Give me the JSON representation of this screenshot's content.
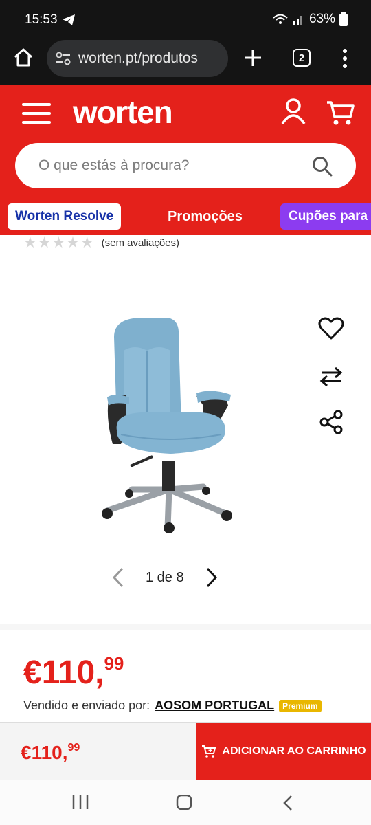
{
  "status_bar": {
    "time": "15:53",
    "battery": "63%"
  },
  "browser": {
    "url": "worten.pt/produtos",
    "tab_count": "2"
  },
  "header": {
    "logo": "worten",
    "search_placeholder": "O que estás à procura?",
    "nav": [
      "Worten Resolve",
      "Promoções",
      "Cupões para"
    ]
  },
  "product": {
    "rating_text": "(sem avaliações)",
    "gallery": "1 de 8",
    "price_int": "€110,",
    "price_dec": "99",
    "seller_label": "Vendido e enviado por:",
    "seller_name": "AOSOM PORTUGAL",
    "seller_badge": "Premium"
  },
  "buy_bar": {
    "price_int": "€110,",
    "price_dec": "99",
    "add_to_cart": "ADICIONAR AO CARRINHO"
  },
  "colors": {
    "brand_red": "#e4211b",
    "resolve_blue": "#1833a8",
    "coupon_purple": "#8c3cf0",
    "premium_gold": "#e9b700"
  }
}
